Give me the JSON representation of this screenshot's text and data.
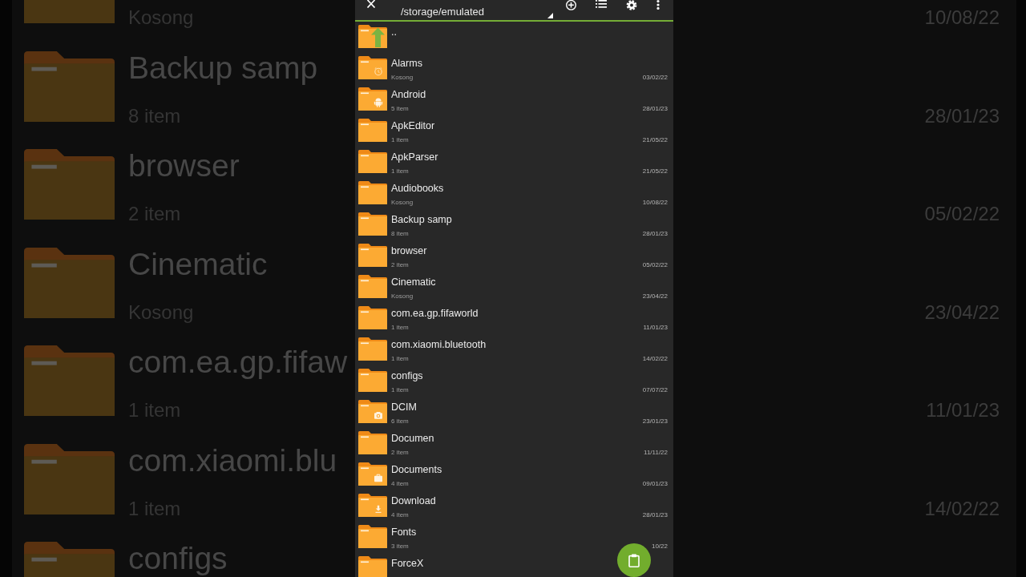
{
  "background_left": {
    "rows": [
      {
        "subtitle": "Kosong"
      },
      {
        "title": "Backup samp",
        "subtitle": "8 item"
      },
      {
        "title": "browser",
        "subtitle": "2 item"
      },
      {
        "title": "Cinematic",
        "subtitle": "Kosong"
      },
      {
        "title": "com.ea.gp.fifaw",
        "subtitle": "1 item"
      },
      {
        "title": "com.xiaomi.blu",
        "subtitle": "1 item"
      },
      {
        "title": "configs"
      }
    ]
  },
  "background_right": {
    "dates": [
      "10/08/22",
      "28/01/23",
      "05/02/22",
      "23/04/22",
      "11/01/23",
      "14/02/22"
    ]
  },
  "toolbar": {
    "path": "/storage/emulated"
  },
  "files": [
    {
      "kind": "up",
      "name": ".."
    },
    {
      "kind": "alarm",
      "name": "Alarms",
      "info": "Kosong",
      "date": "03/02/22"
    },
    {
      "kind": "android",
      "name": "Android",
      "info": "5 item",
      "date": "28/01/23"
    },
    {
      "kind": "plain",
      "name": "ApkEditor",
      "info": "1 item",
      "date": "21/05/22"
    },
    {
      "kind": "plain",
      "name": "ApkParser",
      "info": "1 item",
      "date": "21/05/22"
    },
    {
      "kind": "plain",
      "name": "Audiobooks",
      "info": "Kosong",
      "date": "10/08/22"
    },
    {
      "kind": "plain",
      "name": "Backup samp",
      "info": "8 item",
      "date": "28/01/23"
    },
    {
      "kind": "plain",
      "name": "browser",
      "info": "2 item",
      "date": "05/02/22"
    },
    {
      "kind": "plain",
      "name": "Cinematic",
      "info": "Kosong",
      "date": "23/04/22"
    },
    {
      "kind": "plain",
      "name": "com.ea.gp.fifaworld",
      "info": "1 item",
      "date": "11/01/23"
    },
    {
      "kind": "plain",
      "name": "com.xiaomi.bluetooth",
      "info": "1 item",
      "date": "14/02/22"
    },
    {
      "kind": "plain",
      "name": "configs",
      "info": "1 item",
      "date": "07/07/22"
    },
    {
      "kind": "camera",
      "name": "DCIM",
      "info": "6 item",
      "date": "23/01/23"
    },
    {
      "kind": "plain",
      "name": "Documen",
      "info": "2 item",
      "date": "11/11/22"
    },
    {
      "kind": "briefcase",
      "name": "Documents",
      "info": "4 item",
      "date": "09/01/23"
    },
    {
      "kind": "download",
      "name": "Download",
      "info": "4 item",
      "date": "28/01/23"
    },
    {
      "kind": "plain",
      "name": "Fonts",
      "info": "3 item",
      "date": "10/22"
    },
    {
      "kind": "plain",
      "name": "ForceX"
    }
  ]
}
